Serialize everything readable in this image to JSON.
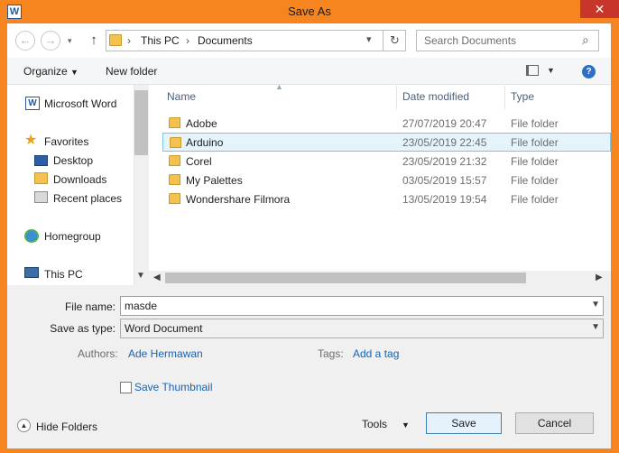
{
  "window": {
    "title": "Save As",
    "app_icon": "W",
    "close": "✕"
  },
  "nav": {
    "back": "←",
    "forward": "→",
    "up": "↑",
    "breadcrumb": [
      "This PC",
      "Documents"
    ],
    "separator": "›",
    "refresh": "↻",
    "search_placeholder": "Search Documents",
    "search_icon": "⌕"
  },
  "toolbar": {
    "organize": "Organize",
    "new_folder": "New folder",
    "help": "?"
  },
  "sidebar": {
    "items": [
      {
        "label": "Microsoft Word",
        "icon": "word-icon"
      },
      {
        "label": "Favorites",
        "icon": "star-icon"
      },
      {
        "label": "Desktop",
        "icon": "desktop-icon"
      },
      {
        "label": "Downloads",
        "icon": "downloads-icon"
      },
      {
        "label": "Recent places",
        "icon": "recent-places-icon"
      },
      {
        "label": "Homegroup",
        "icon": "homegroup-icon"
      },
      {
        "label": "This PC",
        "icon": "computer-icon"
      }
    ]
  },
  "columns": {
    "name": "Name",
    "date_modified": "Date modified",
    "type": "Type"
  },
  "files": [
    {
      "name": "Adobe",
      "date": "27/07/2019 20:47",
      "type": "File folder",
      "selected": false
    },
    {
      "name": "Arduino",
      "date": "23/05/2019 22:45",
      "type": "File folder",
      "selected": true
    },
    {
      "name": "Corel",
      "date": "23/05/2019 21:32",
      "type": "File folder",
      "selected": false
    },
    {
      "name": "My Palettes",
      "date": "03/05/2019 15:57",
      "type": "File folder",
      "selected": false
    },
    {
      "name": "Wondershare Filmora",
      "date": "13/05/2019 19:54",
      "type": "File folder",
      "selected": false
    }
  ],
  "form": {
    "file_name_label": "File name:",
    "file_name_value": "masde",
    "save_type_label": "Save as type:",
    "save_type_value": "Word Document",
    "authors_label": "Authors:",
    "authors_value": "Ade Hermawan",
    "tags_label": "Tags:",
    "tags_value": "Add a tag",
    "thumbnail_label": "Save Thumbnail"
  },
  "footer": {
    "hide_folders": "Hide Folders",
    "tools": "Tools",
    "save": "Save",
    "cancel": "Cancel"
  },
  "colors": {
    "frame": "#f7851f",
    "close": "#c7352b",
    "selection": "#e5f3fb",
    "link": "#1763b5"
  }
}
